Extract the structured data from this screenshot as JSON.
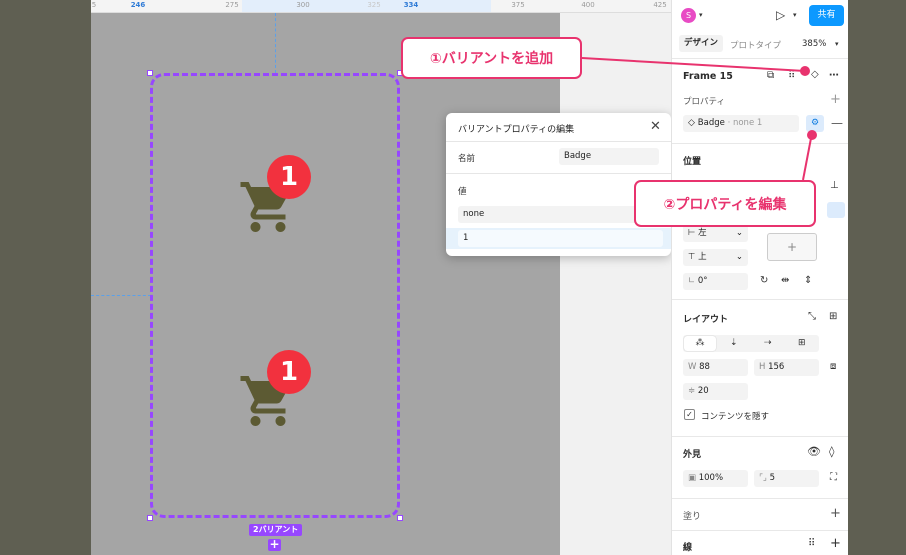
{
  "ruler": {
    "ticks": [
      "5",
      "246",
      "275",
      "300",
      "325",
      "334",
      "375",
      "400",
      "425"
    ]
  },
  "canvas": {
    "variant_label": "2バリアント",
    "variant_add": "+",
    "badge_top": "1",
    "badge_bottom": "1"
  },
  "popup": {
    "title": "バリアントプロパティの編集",
    "close": "✕",
    "name_label": "名前",
    "name_value": "Badge",
    "values_label": "値",
    "value_1": "none",
    "value_2": "1"
  },
  "panel": {
    "avatar": "S",
    "share": "共有",
    "tab_design": "デザイン",
    "tab_prototype": "プロトタイプ",
    "zoom": "385%",
    "frame_name": "Frame 15",
    "properties_label": "プロパティ",
    "prop_name": "Badge",
    "prop_value": "· none 1",
    "position_label": "位置",
    "align_h": "左",
    "align_v": "上",
    "rotation": "0°",
    "layout_label": "レイアウト",
    "w_label": "W",
    "w_value": "88",
    "h_label": "H",
    "h_value": "156",
    "gap_value": "20",
    "clip_label": "コンテンツを隠す",
    "appearance_label": "外見",
    "opacity": "100%",
    "radius": "5",
    "fill_label": "塗り",
    "stroke_label": "線"
  },
  "callouts": {
    "add_variant": "①バリアントを追加",
    "edit_property": "②プロパティを編集"
  },
  "colors": {
    "accent": "#9747ff",
    "callout": "#e8336e",
    "badge": "#f2313e",
    "cart": "#5c5a33",
    "share": "#0d99ff"
  }
}
